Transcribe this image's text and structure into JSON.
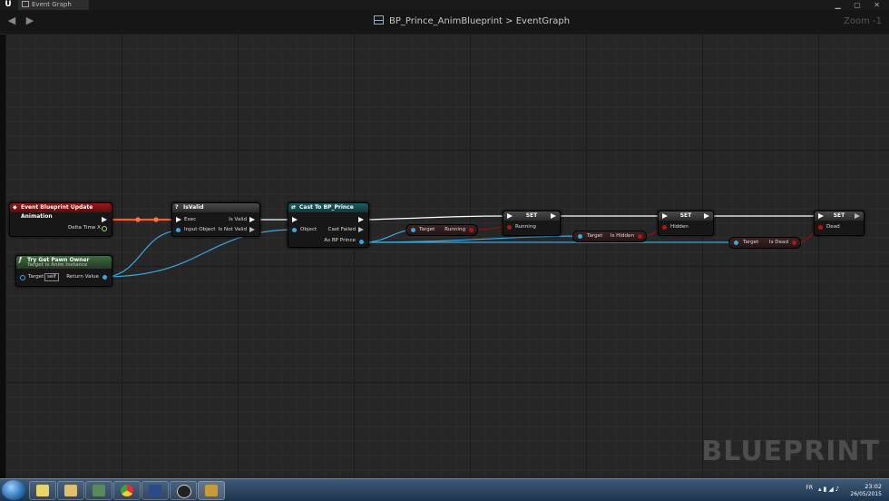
{
  "window": {
    "tab_title": "Event Graph",
    "breadcrumb_blueprint": "BP_Prince_AnimBlueprint",
    "breadcrumb_separator": ">",
    "breadcrumb_graph": "EventGraph",
    "zoom": "Zoom -1",
    "watermark": "BLUEPRINT"
  },
  "nodes": {
    "event_update": {
      "title": "Event Blueprint Update Animation",
      "pin_delta": "Delta Time X"
    },
    "try_get_pawn": {
      "title": "Try Get Pawn Owner",
      "subtitle": "Target is Anim Instance",
      "pin_target": "Target",
      "target_value": "self",
      "pin_return": "Return Value"
    },
    "is_valid": {
      "title": "IsValid",
      "pin_exec": "Exec",
      "pin_input": "Input Object",
      "pin_valid": "Is Valid",
      "pin_not_valid": "Is Not Valid"
    },
    "cast": {
      "title": "Cast To BP_Prince",
      "pin_object": "Object",
      "pin_failed": "Cast Failed",
      "pin_as": "As BP Prince"
    },
    "get_running": {
      "pin_target": "Target",
      "pin_value": "Running"
    },
    "get_hidden": {
      "pin_target": "Target",
      "pin_value": "Is Hidden"
    },
    "get_dead": {
      "pin_target": "Target",
      "pin_value": "Is Dead"
    },
    "set_running": {
      "title": "SET",
      "pin": "Running"
    },
    "set_hidden": {
      "title": "SET",
      "pin": "Hidden"
    },
    "set_dead": {
      "title": "SET",
      "pin": "Dead"
    }
  },
  "colors": {
    "exec_wire": "#ffffff",
    "active_wire": "#ff5a1a",
    "object_wire": "#3aa8e0",
    "bool_wire": "#8b1414",
    "float_pin": "#9fe36a"
  },
  "taskbar": {
    "lang": "FR",
    "time": "23:02",
    "date": "26/05/2015"
  }
}
